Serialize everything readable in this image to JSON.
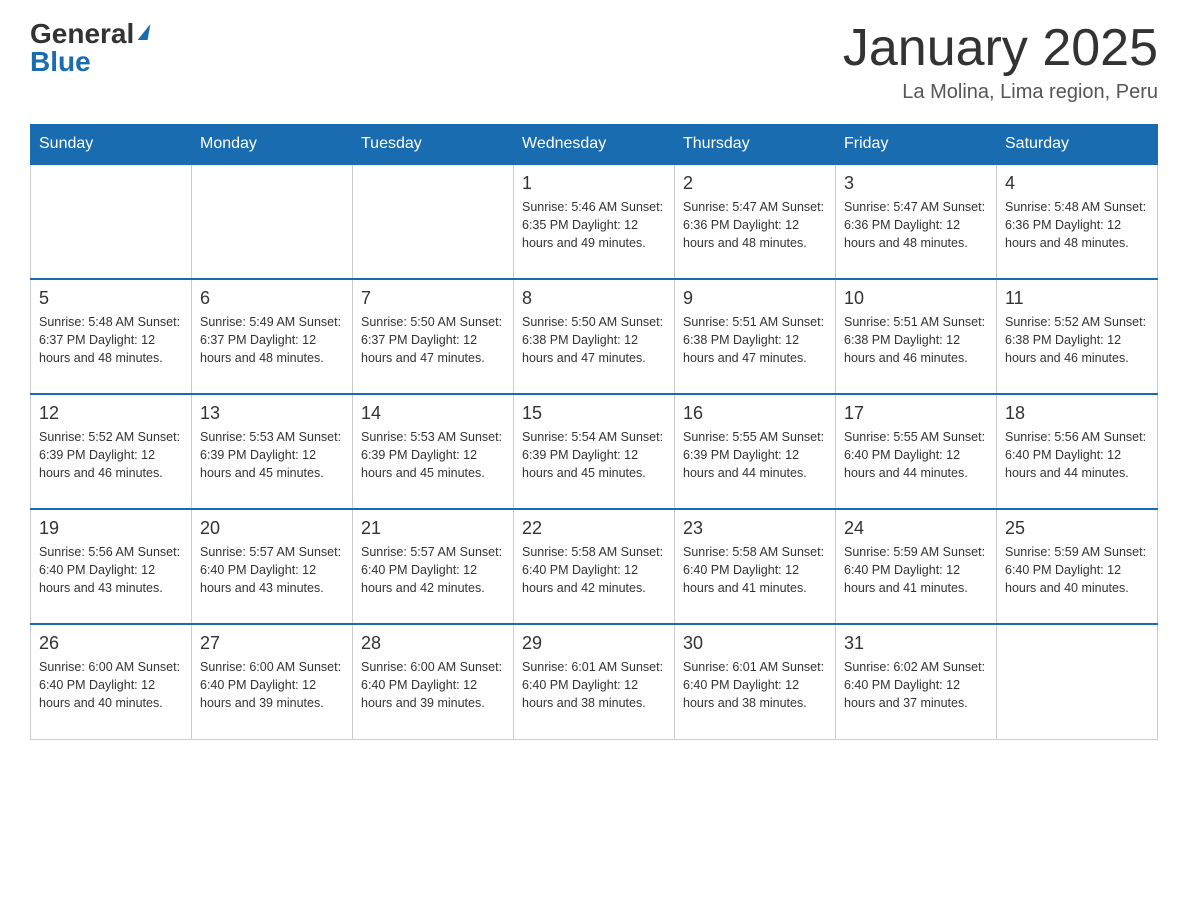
{
  "logo": {
    "general": "General",
    "blue": "Blue"
  },
  "header": {
    "month": "January 2025",
    "location": "La Molina, Lima region, Peru"
  },
  "days_of_week": [
    "Sunday",
    "Monday",
    "Tuesday",
    "Wednesday",
    "Thursday",
    "Friday",
    "Saturday"
  ],
  "weeks": [
    [
      {
        "day": "",
        "info": ""
      },
      {
        "day": "",
        "info": ""
      },
      {
        "day": "",
        "info": ""
      },
      {
        "day": "1",
        "info": "Sunrise: 5:46 AM\nSunset: 6:35 PM\nDaylight: 12 hours\nand 49 minutes."
      },
      {
        "day": "2",
        "info": "Sunrise: 5:47 AM\nSunset: 6:36 PM\nDaylight: 12 hours\nand 48 minutes."
      },
      {
        "day": "3",
        "info": "Sunrise: 5:47 AM\nSunset: 6:36 PM\nDaylight: 12 hours\nand 48 minutes."
      },
      {
        "day": "4",
        "info": "Sunrise: 5:48 AM\nSunset: 6:36 PM\nDaylight: 12 hours\nand 48 minutes."
      }
    ],
    [
      {
        "day": "5",
        "info": "Sunrise: 5:48 AM\nSunset: 6:37 PM\nDaylight: 12 hours\nand 48 minutes."
      },
      {
        "day": "6",
        "info": "Sunrise: 5:49 AM\nSunset: 6:37 PM\nDaylight: 12 hours\nand 48 minutes."
      },
      {
        "day": "7",
        "info": "Sunrise: 5:50 AM\nSunset: 6:37 PM\nDaylight: 12 hours\nand 47 minutes."
      },
      {
        "day": "8",
        "info": "Sunrise: 5:50 AM\nSunset: 6:38 PM\nDaylight: 12 hours\nand 47 minutes."
      },
      {
        "day": "9",
        "info": "Sunrise: 5:51 AM\nSunset: 6:38 PM\nDaylight: 12 hours\nand 47 minutes."
      },
      {
        "day": "10",
        "info": "Sunrise: 5:51 AM\nSunset: 6:38 PM\nDaylight: 12 hours\nand 46 minutes."
      },
      {
        "day": "11",
        "info": "Sunrise: 5:52 AM\nSunset: 6:38 PM\nDaylight: 12 hours\nand 46 minutes."
      }
    ],
    [
      {
        "day": "12",
        "info": "Sunrise: 5:52 AM\nSunset: 6:39 PM\nDaylight: 12 hours\nand 46 minutes."
      },
      {
        "day": "13",
        "info": "Sunrise: 5:53 AM\nSunset: 6:39 PM\nDaylight: 12 hours\nand 45 minutes."
      },
      {
        "day": "14",
        "info": "Sunrise: 5:53 AM\nSunset: 6:39 PM\nDaylight: 12 hours\nand 45 minutes."
      },
      {
        "day": "15",
        "info": "Sunrise: 5:54 AM\nSunset: 6:39 PM\nDaylight: 12 hours\nand 45 minutes."
      },
      {
        "day": "16",
        "info": "Sunrise: 5:55 AM\nSunset: 6:39 PM\nDaylight: 12 hours\nand 44 minutes."
      },
      {
        "day": "17",
        "info": "Sunrise: 5:55 AM\nSunset: 6:40 PM\nDaylight: 12 hours\nand 44 minutes."
      },
      {
        "day": "18",
        "info": "Sunrise: 5:56 AM\nSunset: 6:40 PM\nDaylight: 12 hours\nand 44 minutes."
      }
    ],
    [
      {
        "day": "19",
        "info": "Sunrise: 5:56 AM\nSunset: 6:40 PM\nDaylight: 12 hours\nand 43 minutes."
      },
      {
        "day": "20",
        "info": "Sunrise: 5:57 AM\nSunset: 6:40 PM\nDaylight: 12 hours\nand 43 minutes."
      },
      {
        "day": "21",
        "info": "Sunrise: 5:57 AM\nSunset: 6:40 PM\nDaylight: 12 hours\nand 42 minutes."
      },
      {
        "day": "22",
        "info": "Sunrise: 5:58 AM\nSunset: 6:40 PM\nDaylight: 12 hours\nand 42 minutes."
      },
      {
        "day": "23",
        "info": "Sunrise: 5:58 AM\nSunset: 6:40 PM\nDaylight: 12 hours\nand 41 minutes."
      },
      {
        "day": "24",
        "info": "Sunrise: 5:59 AM\nSunset: 6:40 PM\nDaylight: 12 hours\nand 41 minutes."
      },
      {
        "day": "25",
        "info": "Sunrise: 5:59 AM\nSunset: 6:40 PM\nDaylight: 12 hours\nand 40 minutes."
      }
    ],
    [
      {
        "day": "26",
        "info": "Sunrise: 6:00 AM\nSunset: 6:40 PM\nDaylight: 12 hours\nand 40 minutes."
      },
      {
        "day": "27",
        "info": "Sunrise: 6:00 AM\nSunset: 6:40 PM\nDaylight: 12 hours\nand 39 minutes."
      },
      {
        "day": "28",
        "info": "Sunrise: 6:00 AM\nSunset: 6:40 PM\nDaylight: 12 hours\nand 39 minutes."
      },
      {
        "day": "29",
        "info": "Sunrise: 6:01 AM\nSunset: 6:40 PM\nDaylight: 12 hours\nand 38 minutes."
      },
      {
        "day": "30",
        "info": "Sunrise: 6:01 AM\nSunset: 6:40 PM\nDaylight: 12 hours\nand 38 minutes."
      },
      {
        "day": "31",
        "info": "Sunrise: 6:02 AM\nSunset: 6:40 PM\nDaylight: 12 hours\nand 37 minutes."
      },
      {
        "day": "",
        "info": ""
      }
    ]
  ]
}
